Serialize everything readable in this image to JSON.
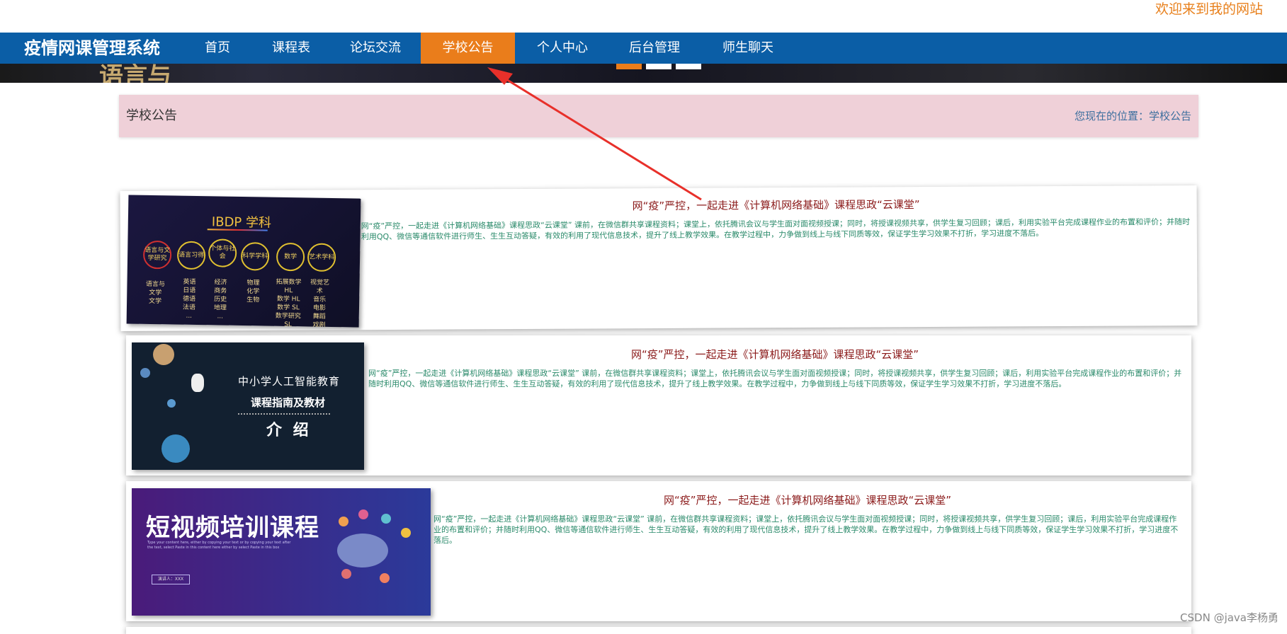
{
  "header": {
    "welcome": "欢迎来到我的网站"
  },
  "nav": {
    "brand": "疫情网课管理系统",
    "items": [
      {
        "label": "首页"
      },
      {
        "label": "课程表"
      },
      {
        "label": "论坛交流"
      },
      {
        "label": "学校公告"
      },
      {
        "label": "个人中心"
      },
      {
        "label": "后台管理"
      },
      {
        "label": "师生聊天"
      }
    ],
    "active_index": 3
  },
  "banner": {
    "partial_text": "语言与"
  },
  "breadcrumb": {
    "title": "学校公告",
    "location": "您现在的位置：学校公告"
  },
  "announcements": [
    {
      "title": "网“疫”严控，一起走进《计算机网络基础》课程思政“云课堂”",
      "desc": "网“疫”严控，一起走进《计算机网络基础》课程思政“云课堂” 课前，在微信群共享课程资料；课堂上，依托腾讯会议与学生面对面视频授课；同时，将授课视频共享，供学生复习回顾；课后，利用实验平台完成课程作业的布置和评价；并随时利用QQ、微信等通信软件进行师生、生生互动答疑，有效的利用了现代信息技术，提升了线上教学效果。在教学过程中，力争做到线上与线下同质等效，保证学生学习效果不打折，学习进度不落后。",
      "thumb": {
        "heading": "IBDP 学科",
        "circles": [
          "语言与文学研究",
          "语言习得",
          "个体与社会",
          "科学学科",
          "数学",
          "艺术学科"
        ],
        "columns": [
          "语言与\n文学\n文学",
          "英语\n日语\n德语\n法语\n...",
          "经济\n商务\n历史\n地理\n...",
          "物理\n化学\n生物",
          "拓展数学\nHL\n数学 HL\n数学 SL\n数学研究\nSL",
          "视觉艺\n术\n音乐\n电影\n舞蹈\n戏剧"
        ]
      }
    },
    {
      "title": "网“疫”严控，一起走进《计算机网络基础》课程思政“云课堂”",
      "desc": "网“疫”严控，一起走进《计算机网络基础》课程思政“云课堂” 课前，在微信群共享课程资料；课堂上，依托腾讯会议与学生面对面视频授课；同时，将授课视频共享，供学生复习回顾；课后，利用实验平台完成课程作业的布置和评价；并随时利用QQ、微信等通信软件进行师生、生生互动答疑，有效的利用了现代信息技术，提升了线上教学效果。在教学过程中，力争做到线上与线下同质等效，保证学生学习效果不打折，学习进度不落后。",
      "thumb": {
        "line1": "中小学人工智能教育",
        "line2": "课程指南及教材",
        "line3": "介 绍"
      }
    },
    {
      "title": "网“疫”严控，一起走进《计算机网络基础》课程思政“云课堂”",
      "desc": "网“疫”严控，一起走进《计算机网络基础》课程思政“云课堂” 课前，在微信群共享课程资料；课堂上，依托腾讯会议与学生面对面视频授课；同时，将授课视频共享，供学生复习回顾；课后，利用实验平台完成课程作业的布置和评价；并随时利用QQ、微信等通信软件进行师生、生生互动答疑，有效的利用了现代信息技术，提升了线上教学效果。在教学过程中，力争做到线上与线下同质等效，保证学生学习效果不打折，学习进度不落后。",
      "thumb": {
        "heading": "短视频培训课程",
        "sub": "Type your content here, either by copying your text or by copying your text after the text, select Paste in this content here either by select Paste in this box",
        "presenter": "演讲人：XXX"
      }
    }
  ],
  "watermark": "CSDN @java李杨勇",
  "colors": {
    "nav_bg": "#0b5ea6",
    "nav_active": "#ea7d1b",
    "welcome": "#e8801c",
    "crumb_bg": "#efd0d8",
    "title_color": "#8b1a1a",
    "desc_color": "#2a8a6a",
    "arrow": "#e8302a"
  }
}
